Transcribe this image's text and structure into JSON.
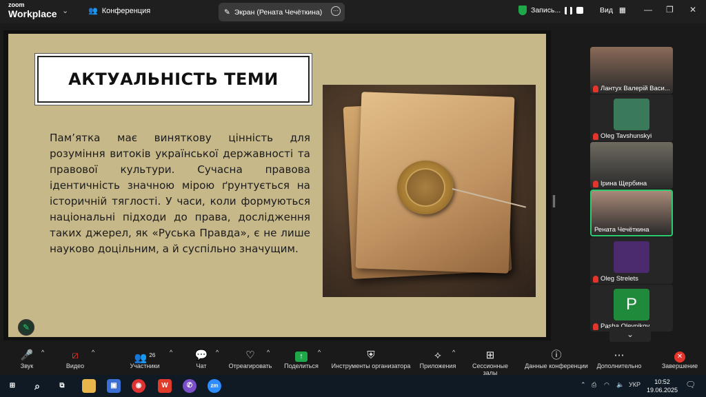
{
  "titlebar": {
    "logo_line1": "zoom",
    "logo_line2": "Workplace",
    "conference_label": "Конференция",
    "screen_tab_label": "Экран (Рената Чечёткина)",
    "recording_label": "Запись...",
    "view_label": "Вид"
  },
  "slide": {
    "title": "АКТУАЛЬНІСТЬ ТЕМИ",
    "body": "Пам’ятка має виняткову цінність для розуміння витоків української державності та правової культури. Сучасна правова ідентичність значною мірою ґрунтується на історичній тяглості. У часи, коли формуються національні підходи до права, дослідження таких джерел, як «Руська Правда», є не лише науково доцільним, а й суспільно значущим."
  },
  "participants": [
    {
      "name": "Лантух Валерій Васи...",
      "muted": true,
      "type": "video",
      "color": "#8a6a58"
    },
    {
      "name": "Oleg Tavshunskyi",
      "muted": true,
      "type": "avatar",
      "color": "#3a7a5a"
    },
    {
      "name": "Ірина Щербина",
      "muted": true,
      "type": "video",
      "color": "#6e6a60"
    },
    {
      "name": "Рената Чечёткина",
      "muted": false,
      "type": "video",
      "color": "#a88a78",
      "active": true
    },
    {
      "name": "Oleg Strelets",
      "muted": true,
      "type": "avatar",
      "color": "#4b2a6e"
    },
    {
      "name": "Pasha Oleynikov",
      "muted": true,
      "type": "letter",
      "letter": "P",
      "color": "#1f8a3a"
    }
  ],
  "toolbar": {
    "sound": "Звук",
    "video": "Видео",
    "participants": "Участники",
    "participants_count": "26",
    "chat": "Чат",
    "react": "Отреагировать",
    "share": "Поделиться",
    "host_tools": "Инструменты организатора",
    "apps": "Приложения",
    "breakout": "Сессионные залы",
    "meeting_info": "Данные конференции",
    "more": "Дополнительно",
    "end": "Завершение"
  },
  "taskbar": {
    "lang": "УКР",
    "time": "10:52",
    "date": "19.06.2025",
    "apps": [
      "file-explorer-icon",
      "save-icon",
      "chrome-icon",
      "wps-icon",
      "viber-icon",
      "zoom-icon"
    ]
  }
}
